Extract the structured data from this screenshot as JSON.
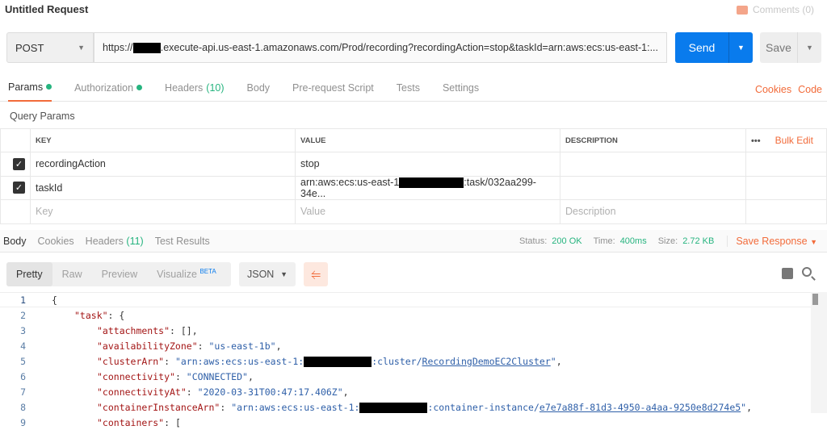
{
  "header": {
    "title": "Untitled Request",
    "comments": "Comments (0)"
  },
  "request": {
    "method": "POST",
    "url_prefix": "https://",
    "url_suffix": ".execute-api.us-east-1.amazonaws.com/Prod/recording?recordingAction=stop&taskId=arn:aws:ecs:us-east-1:...",
    "send": "Send",
    "save": "Save"
  },
  "tabs": {
    "params": "Params",
    "authorization": "Authorization",
    "headers": "Headers",
    "headers_count": "(10)",
    "body": "Body",
    "prerequest": "Pre-request Script",
    "tests": "Tests",
    "settings": "Settings",
    "cookies": "Cookies",
    "code": "Code"
  },
  "params": {
    "title": "Query Params",
    "columns": [
      "KEY",
      "VALUE",
      "DESCRIPTION"
    ],
    "bulk_edit": "Bulk Edit",
    "more": "•••",
    "rows": [
      {
        "key": "recordingAction",
        "value": "stop",
        "checked": true
      },
      {
        "key": "taskId",
        "value_prefix": "arn:aws:ecs:us-east-1",
        "value_suffix": ":task/032aa299-34e...",
        "checked": true
      }
    ],
    "placeholders": {
      "key": "Key",
      "value": "Value",
      "description": "Description"
    }
  },
  "response": {
    "tabs": {
      "body": "Body",
      "cookies": "Cookies",
      "headers": "Headers",
      "headers_count": "(11)",
      "tests": "Test Results"
    },
    "status_label": "Status:",
    "status": "200 OK",
    "time_label": "Time:",
    "time": "400ms",
    "size_label": "Size:",
    "size": "2.72 KB",
    "save_response": "Save Response",
    "views": {
      "pretty": "Pretty",
      "raw": "Raw",
      "preview": "Preview",
      "visualize": "Visualize",
      "beta": "BETA"
    },
    "format": "JSON"
  },
  "code": {
    "l1": "{",
    "l2k": "\"task\"",
    "l2r": ": {",
    "l3k": "\"attachments\"",
    "l3r": ": [],",
    "l4k": "\"availabilityZone\"",
    "l4v": "\"us-east-1b\"",
    "l5k": "\"clusterArn\"",
    "l5v1": "\"arn:aws:ecs:us-east-1:",
    "l5v2": ":cluster/",
    "l5v3": "RecordingDemoEC2Cluster",
    "l5v4": "\"",
    "l6k": "\"connectivity\"",
    "l6v": "\"CONNECTED\"",
    "l7k": "\"connectivityAt\"",
    "l7v": "\"2020-03-31T00:47:17.406Z\"",
    "l8k": "\"containerInstanceArn\"",
    "l8v1": "\"arn:aws:ecs:us-east-1:",
    "l8v2": ":container-instance/",
    "l8v3": "e7e7a88f-81d3-4950-a4aa-9250e8d274e5",
    "l8v4": "\"",
    "l9k": "\"containers\"",
    "l9r": ": ["
  }
}
